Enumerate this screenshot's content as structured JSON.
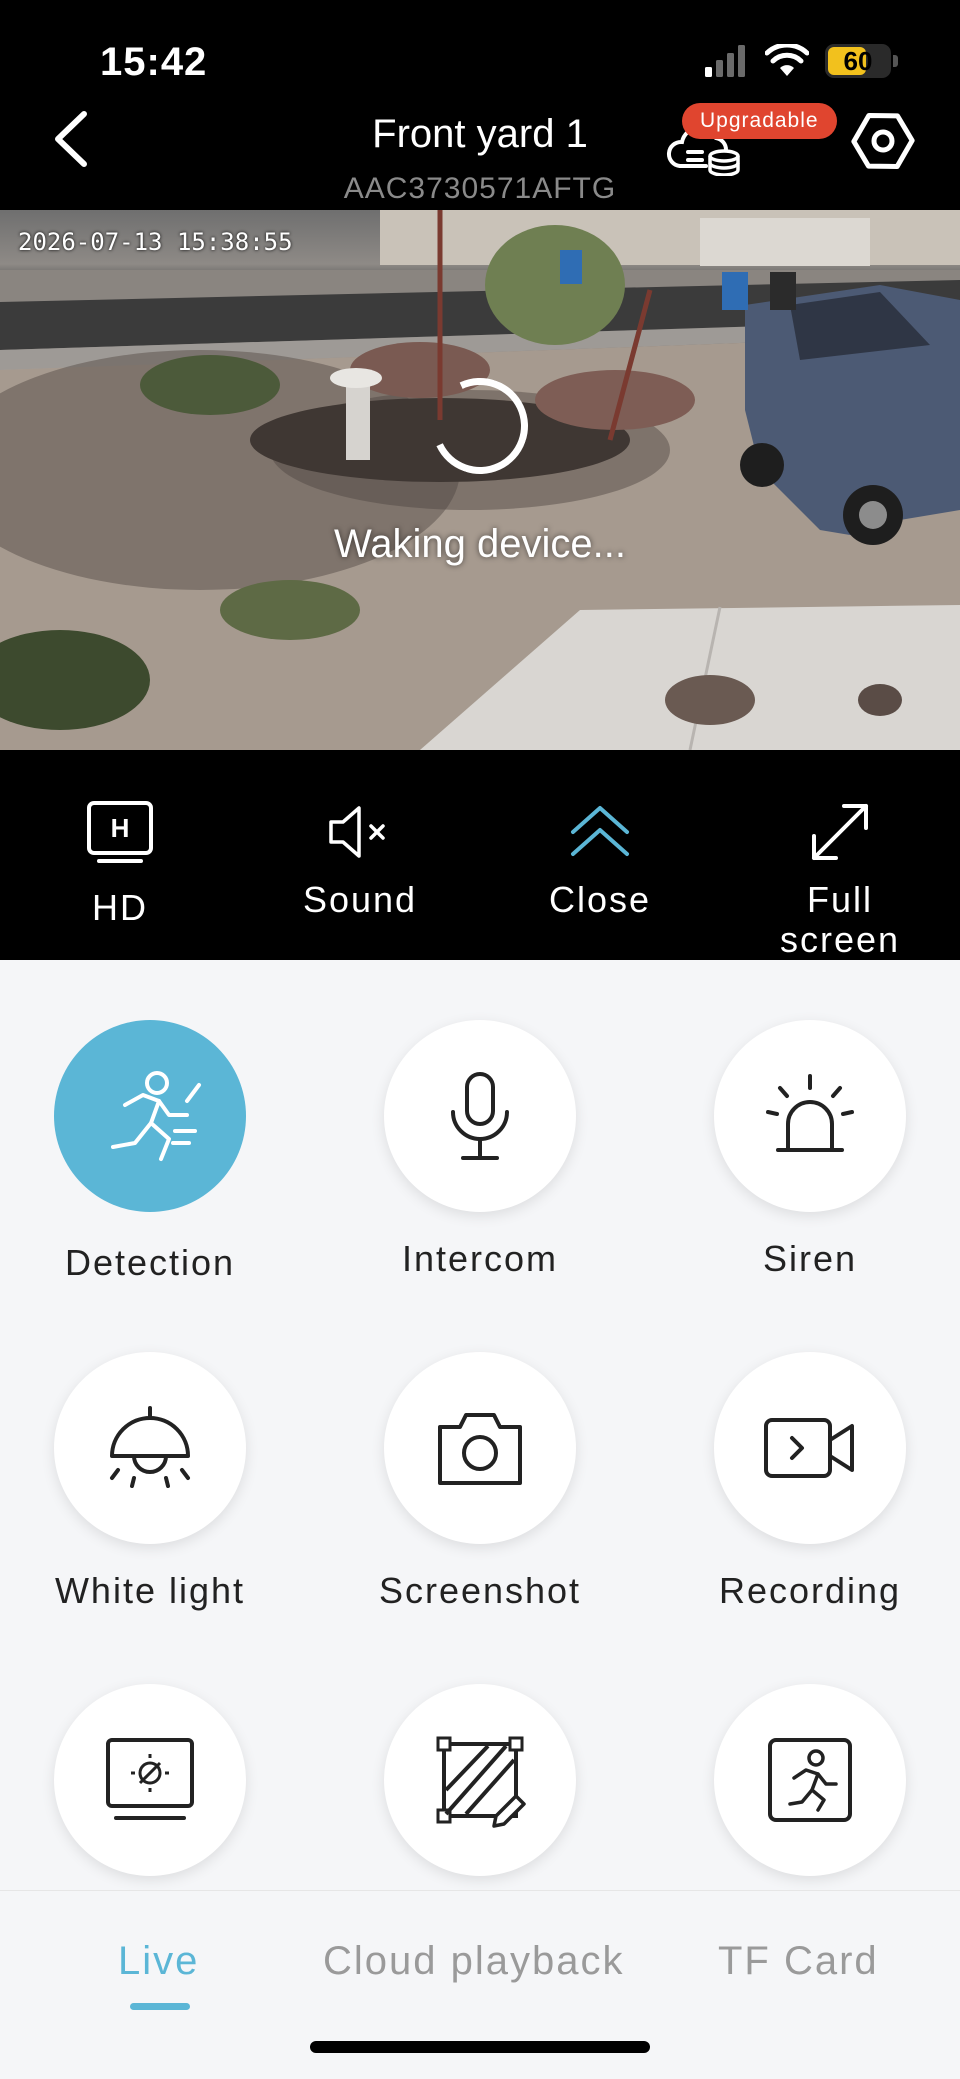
{
  "status_bar": {
    "time": "15:42",
    "battery_level": "60",
    "battery_color": "#f2c11d"
  },
  "header": {
    "title": "Front yard 1",
    "device_id": "AAC3730571AFTG",
    "upgrade_badge": "Upgradable",
    "badge_color": "#e0452f"
  },
  "video": {
    "timestamp": "2026-07-13 15:38:55",
    "status_text": "Waking device..."
  },
  "controls": {
    "hd_icon_text": "H",
    "hd_label": "HD",
    "sound_label": "Sound",
    "close_label": "Close",
    "fullscreen_label": "Full screen"
  },
  "features": [
    {
      "label": "Detection",
      "icon": "running-person-icon",
      "active": true
    },
    {
      "label": "Intercom",
      "icon": "microphone-icon",
      "active": false
    },
    {
      "label": "Siren",
      "icon": "siren-icon",
      "active": false
    },
    {
      "label": "White light",
      "icon": "lamp-icon",
      "active": false
    },
    {
      "label": "Screenshot",
      "icon": "camera-icon",
      "active": false
    },
    {
      "label": "Recording",
      "icon": "video-record-icon",
      "active": false
    },
    {
      "label": "",
      "icon": "brightness-monitor-icon",
      "active": false
    },
    {
      "label": "",
      "icon": "detection-zone-icon",
      "active": false
    },
    {
      "label": "",
      "icon": "human-frame-icon",
      "active": false
    }
  ],
  "tabs": [
    {
      "label": "Live",
      "active": true
    },
    {
      "label": "Cloud playback",
      "active": false
    },
    {
      "label": "TF Card",
      "active": false
    }
  ],
  "accent_color": "#5bb6d6"
}
